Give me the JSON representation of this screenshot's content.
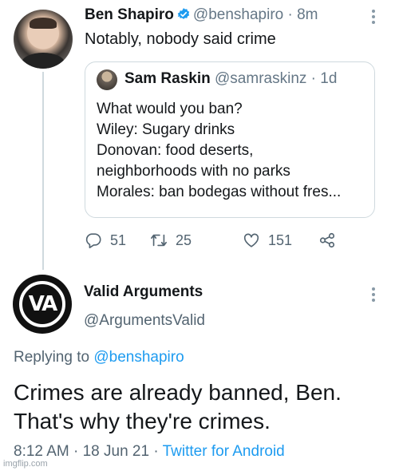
{
  "tweet": {
    "author_name": "Ben Shapiro",
    "author_handle": "@benshapiro",
    "time": "8m",
    "separator": "·",
    "text": "Notably, nobody said crime",
    "quote": {
      "author_name": "Sam Raskin",
      "author_handle": "@samraskinz",
      "time": "1d",
      "separator": "·",
      "lines": [
        "What would you ban?",
        "Wiley: Sugary drinks",
        "Donovan: food deserts,",
        "neighborhoods with no parks",
        "Morales: ban bodegas without fres..."
      ]
    },
    "actions": {
      "replies": "51",
      "retweets": "25",
      "likes": "151"
    }
  },
  "reply": {
    "author_name": "Valid Arguments",
    "author_handle": "@ArgumentsValid",
    "avatar_text": "VA",
    "replying_label": "Replying to",
    "replying_to": "@benshapiro",
    "text_lines": [
      "Crimes are already banned, Ben.",
      "That's why they're crimes."
    ],
    "time": "8:12 AM",
    "date": "18 Jun 21",
    "separator": "·",
    "source": "Twitter for Android"
  },
  "watermark": "imgflip.com",
  "colors": {
    "text": "#14171a",
    "secondary": "#536471",
    "link": "#1d9bf0",
    "verified": "#1d9bf0",
    "border": "#cfd9de"
  },
  "icons": [
    "verified-badge-icon",
    "more-icon",
    "reply-icon",
    "retweet-icon",
    "like-icon",
    "share-icon"
  ]
}
